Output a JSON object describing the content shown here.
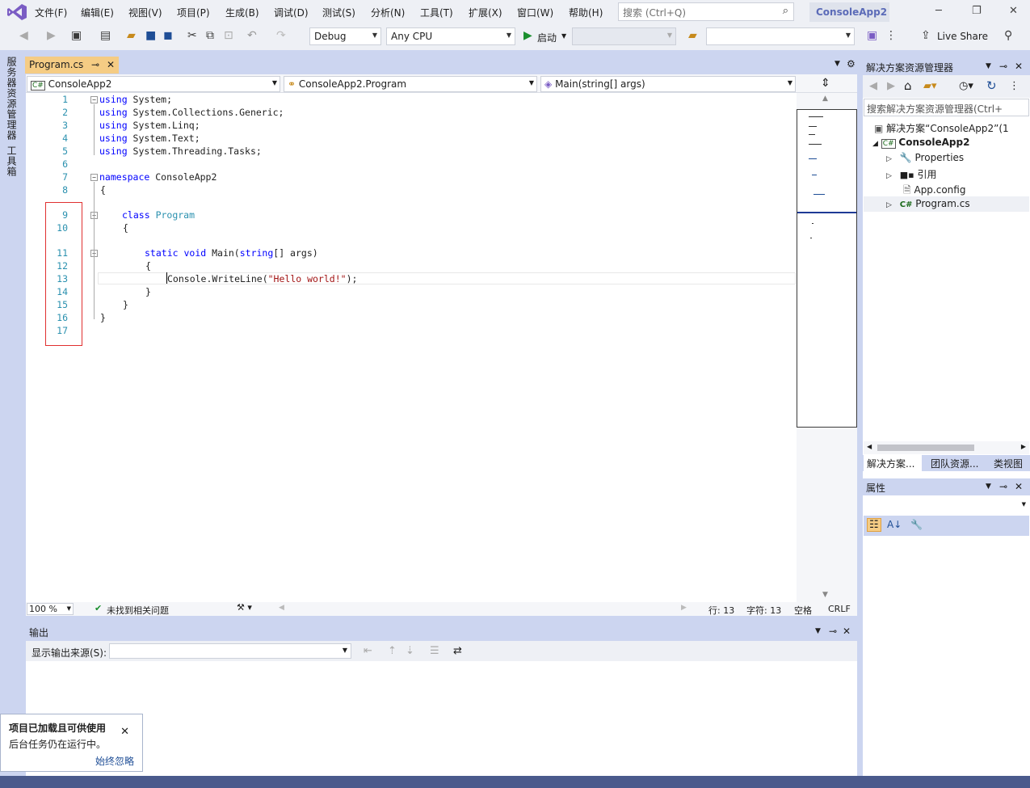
{
  "menubar": {
    "items": [
      "文件(F)",
      "编辑(E)",
      "视图(V)",
      "项目(P)",
      "生成(B)",
      "调试(D)",
      "测试(S)",
      "分析(N)",
      "工具(T)",
      "扩展(X)",
      "窗口(W)",
      "帮助(H)"
    ],
    "search_placeholder": "搜索 (Ctrl+Q)",
    "app_title": "ConsoleApp2"
  },
  "toolbar": {
    "config": "Debug",
    "platform": "Any CPU",
    "start_label": "启动",
    "live_share": "Live Share"
  },
  "left_tabs": {
    "server_explorer": "服务器资源管理器",
    "toolbox": "工具箱"
  },
  "editor": {
    "tab_name": "Program.cs",
    "nav_project": "ConsoleApp2",
    "nav_class": "ConsoleApp2.Program",
    "nav_member": "Main(string[] args)",
    "line_numbers": [
      "1",
      "2",
      "3",
      "4",
      "5",
      "6",
      "7",
      "8",
      "9",
      "10",
      "11",
      "12",
      "13",
      "14",
      "15",
      "16",
      "17"
    ],
    "code": {
      "l1_kw": "using",
      "l1": " System;",
      "l2_kw": "using",
      "l2": " System.Collections.Generic;",
      "l3_kw": "using",
      "l3": " System.Linq;",
      "l4_kw": "using",
      "l4": " System.Text;",
      "l5_kw": "using",
      "l5": " System.Threading.Tasks;",
      "l7_kw": "namespace",
      "l7": " ConsoleApp2",
      "l8": "{",
      "l9_kw": "class",
      "l9_ty": "Program",
      "l10": "{",
      "l11_kw1": "static",
      "l11_kw2": "void",
      "l11_a": " Main(",
      "l11_kw3": "string",
      "l11_b": "[] args)",
      "l12": "{",
      "l13_a": "Console.WriteLine(",
      "l13_str": "\"Hello world!\"",
      "l13_b": ");",
      "l14": "}",
      "l15": "}",
      "l16": "}"
    },
    "zoom": "100 %",
    "issues": "未找到相关问题",
    "line": "行: 13",
    "col": "字符: 13",
    "indent": "空格",
    "eol": "CRLF"
  },
  "output": {
    "title": "输出",
    "source_label": "显示输出来源(S):"
  },
  "solution_explorer": {
    "title": "解决方案资源管理器",
    "search_placeholder": "搜索解决方案资源管理器(Ctrl+",
    "solution": "解决方案“ConsoleApp2”(1",
    "project": "ConsoleApp2",
    "items": [
      "Properties",
      "引用",
      "App.config",
      "Program.cs"
    ],
    "tabs": [
      "解决方案...",
      "团队资源...",
      "类视图"
    ]
  },
  "properties": {
    "title": "属性"
  },
  "notification": {
    "title": "项目已加载且可供使用",
    "body": "后台任务仍在运行中。",
    "link": "始终忽略"
  },
  "colors": {
    "accent": "#5b6bb8",
    "tab_active": "#f5cc84",
    "keyword": "#0000ff",
    "type": "#2b91af",
    "string": "#a31515"
  }
}
